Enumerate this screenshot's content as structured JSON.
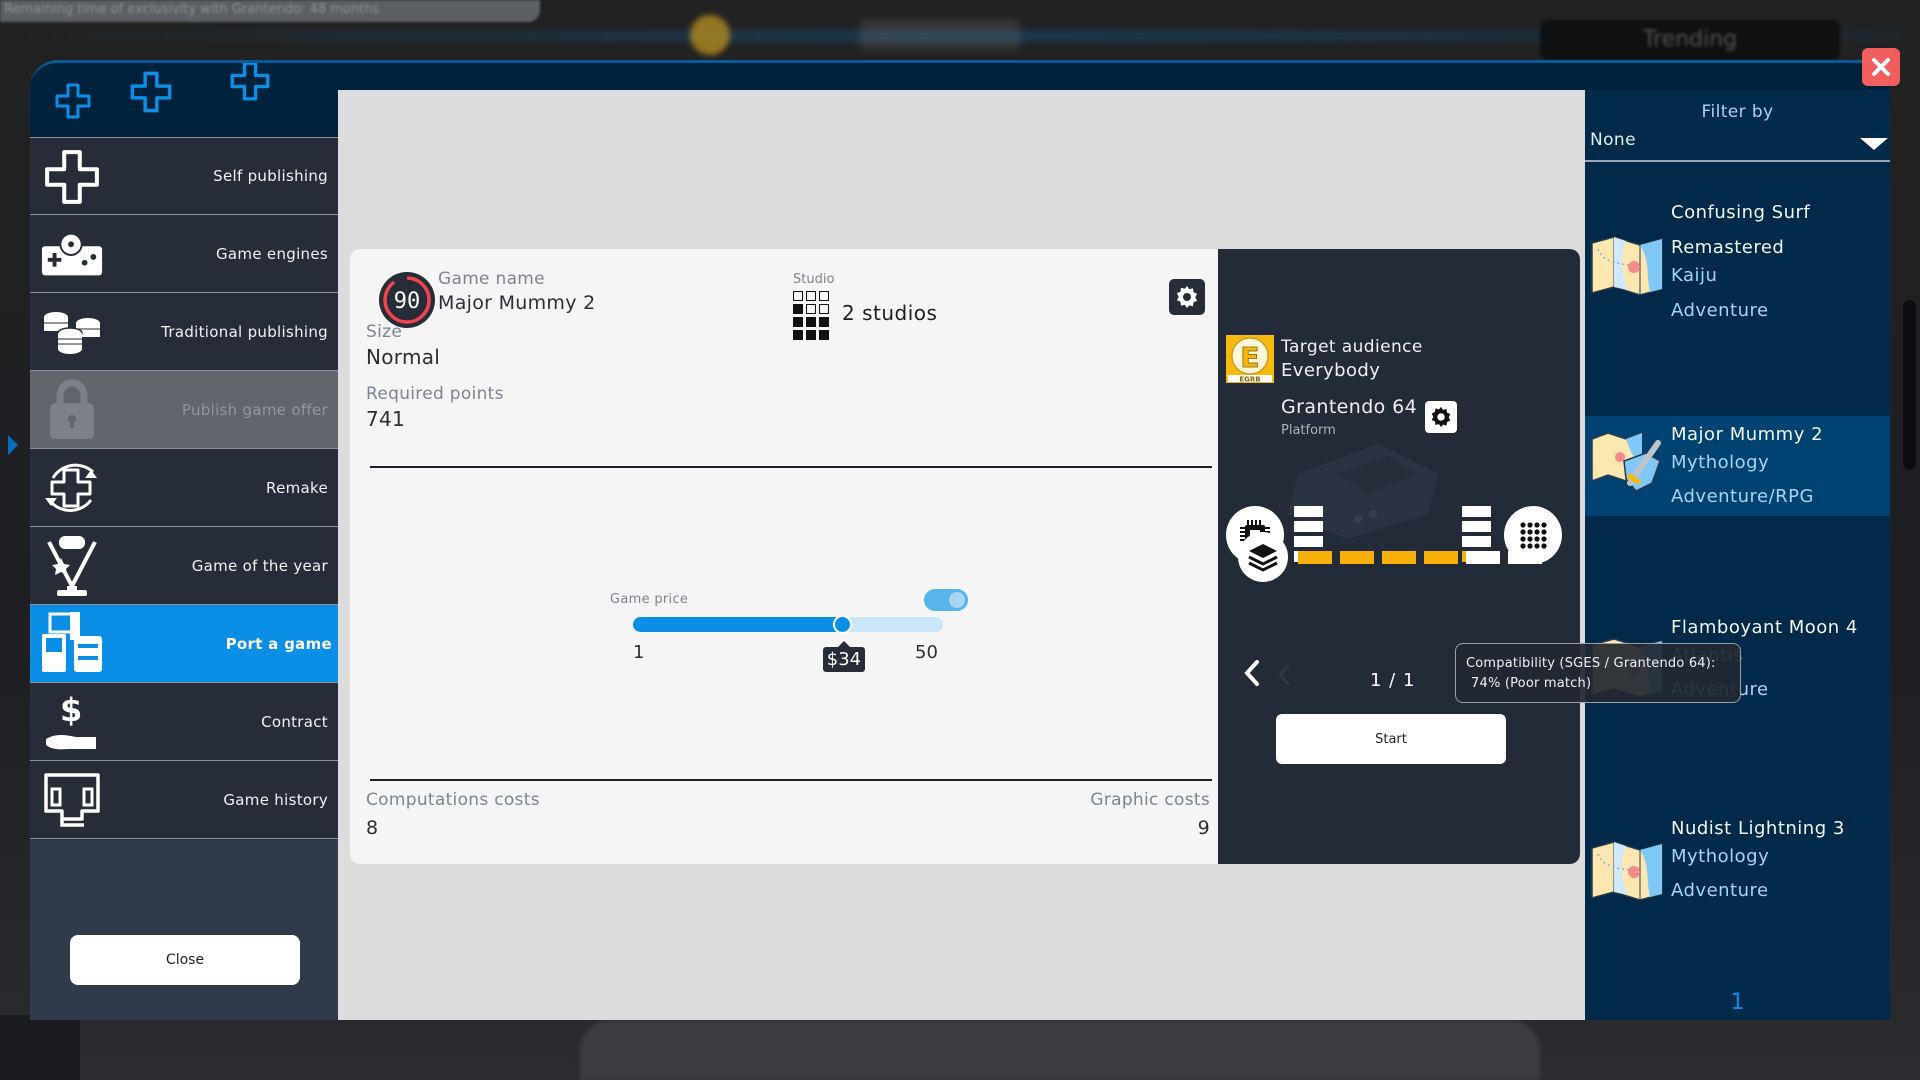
{
  "background": {
    "banner_text": "Remaining time of exclusivity with Grantendo: 48 months",
    "trending_label": "Trending"
  },
  "window": {
    "close_icon": "close-x-icon",
    "accent_color": "#0a8ee6",
    "close_color": "#f15e5e"
  },
  "sidebar": {
    "items": [
      {
        "label": "Self publishing",
        "icon": "dpad-icon",
        "state": "normal"
      },
      {
        "label": "Game engines",
        "icon": "gamepad-gear-icon",
        "state": "normal"
      },
      {
        "label": "Traditional publishing",
        "icon": "coins-icon",
        "state": "normal"
      },
      {
        "label": "Publish game offer",
        "icon": "lock-icon",
        "state": "disabled"
      },
      {
        "label": "Remake",
        "icon": "dpad-cycle-icon",
        "state": "normal"
      },
      {
        "label": "Game of the year",
        "icon": "trophy-icon",
        "state": "normal"
      },
      {
        "label": "Port a game",
        "icon": "devices-icon",
        "state": "active"
      },
      {
        "label": "Contract",
        "icon": "dollar-hand-icon",
        "state": "normal"
      },
      {
        "label": "Game history",
        "icon": "monitor-history-icon",
        "state": "normal"
      }
    ],
    "close_label": "Close"
  },
  "game_card": {
    "score": "90",
    "score_fraction": 0.9,
    "game_name_label": "Game name",
    "game_name": "Major Mummy 2",
    "studio_label": "Studio",
    "studio_value": "2 studios",
    "size_label": "Size",
    "size_value": "Normal",
    "required_points_label": "Required points",
    "required_points_value": "741",
    "price": {
      "label": "Game price",
      "min": 1,
      "max": 50,
      "value": 34,
      "min_label": "1",
      "max_label": "50",
      "value_label": "$34",
      "toggle_on": true
    },
    "computations_costs_label": "Computations costs",
    "computations_costs_value": "8",
    "graphic_costs_label": "Graphic costs",
    "graphic_costs_value": "9"
  },
  "platform_panel": {
    "rating_badge": "E",
    "rating_badge_org": "EGRB",
    "target_audience_label": "Target audience",
    "target_audience_value": "Everybody",
    "platform_name": "Grantendo 64",
    "platform_label": "Platform",
    "cpu_level": 0,
    "cpu_max": 4,
    "gpu_level": 1,
    "gpu_max": 4,
    "compatibility_level": 4,
    "compatibility_max": 6,
    "pager": "1 / 1",
    "start_label": "Start"
  },
  "tooltip": {
    "line1": "Compatibility (SGES / Grantendo 64):",
    "line2": "74% (Poor match)"
  },
  "game_list": {
    "filter_label": "Filter by",
    "filter_value": "None",
    "items": [
      {
        "title": "Confusing Surf",
        "lines": [
          "Remastered",
          "Kaiju",
          "Adventure"
        ],
        "icon": "map-icon",
        "selected": false
      },
      {
        "title": "Major Mummy 2",
        "lines": [
          "Mythology",
          "Adventure/RPG"
        ],
        "icon": "map-sword-icon",
        "selected": true
      },
      {
        "title": "Flamboyant Moon 4",
        "lines": [
          "Atlantis",
          "Adventure"
        ],
        "icon": "map-icon",
        "selected": false
      },
      {
        "title": "Nudist Lightning 3",
        "lines": [
          "Mythology",
          "Adventure"
        ],
        "icon": "map-icon",
        "selected": false
      }
    ],
    "page": "1"
  }
}
